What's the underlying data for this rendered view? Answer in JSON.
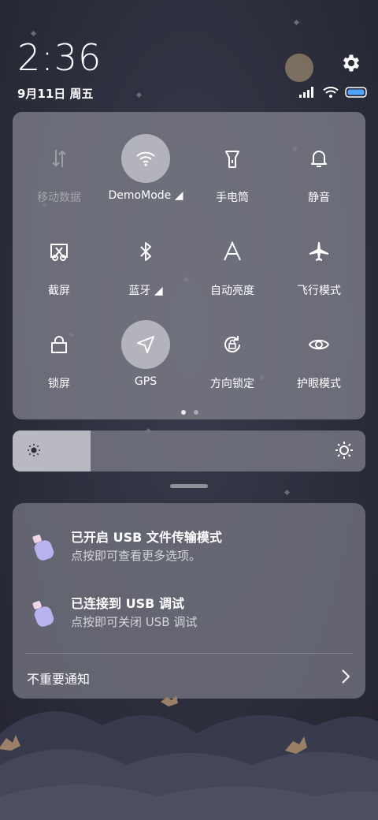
{
  "status_bar": {
    "time": "2:36",
    "date": "9月11日 周五",
    "icons": [
      "signal-icon",
      "wifi-icon",
      "battery-icon"
    ]
  },
  "settings_icon": "gear-icon",
  "quick_tiles": [
    {
      "label": "移动数据",
      "icon": "mobile-data-icon",
      "active": false,
      "disabled": true
    },
    {
      "label": "DemoMode ◢",
      "icon": "wifi-icon",
      "active": true,
      "disabled": false
    },
    {
      "label": "手电筒",
      "icon": "flashlight-icon",
      "active": false,
      "disabled": false
    },
    {
      "label": "静音",
      "icon": "bell-icon",
      "active": false,
      "disabled": false
    },
    {
      "label": "截屏",
      "icon": "screenshot-icon",
      "active": false,
      "disabled": false
    },
    {
      "label": "蓝牙 ◢",
      "icon": "bluetooth-icon",
      "active": false,
      "disabled": false
    },
    {
      "label": "自动亮度",
      "icon": "auto-brightness-icon",
      "active": false,
      "disabled": false
    },
    {
      "label": "飞行模式",
      "icon": "airplane-icon",
      "active": false,
      "disabled": false
    },
    {
      "label": "锁屏",
      "icon": "lock-icon",
      "active": false,
      "disabled": false
    },
    {
      "label": "GPS",
      "icon": "location-arrow-icon",
      "active": true,
      "disabled": false
    },
    {
      "label": "方向锁定",
      "icon": "rotation-lock-icon",
      "active": false,
      "disabled": false
    },
    {
      "label": "护眼模式",
      "icon": "eye-icon",
      "active": false,
      "disabled": false
    }
  ],
  "pager": {
    "pages": 2,
    "current": 1
  },
  "brightness": {
    "level": 0.22,
    "min_icon": "sun-small-icon",
    "max_icon": "sun-large-icon"
  },
  "notifications": [
    {
      "title": "已开启 USB 文件传输模式",
      "text": "点按即可查看更多选项。",
      "icon": "usb-icon"
    },
    {
      "title": "已连接到 USB 调试",
      "text": "点按即可关闭 USB 调试",
      "icon": "usb-icon"
    }
  ],
  "unimportant_label": "不重要通知",
  "colors": {
    "panel": "#7e7f89",
    "active_tile": "#b9bac2",
    "background": "#2b2d3b"
  }
}
